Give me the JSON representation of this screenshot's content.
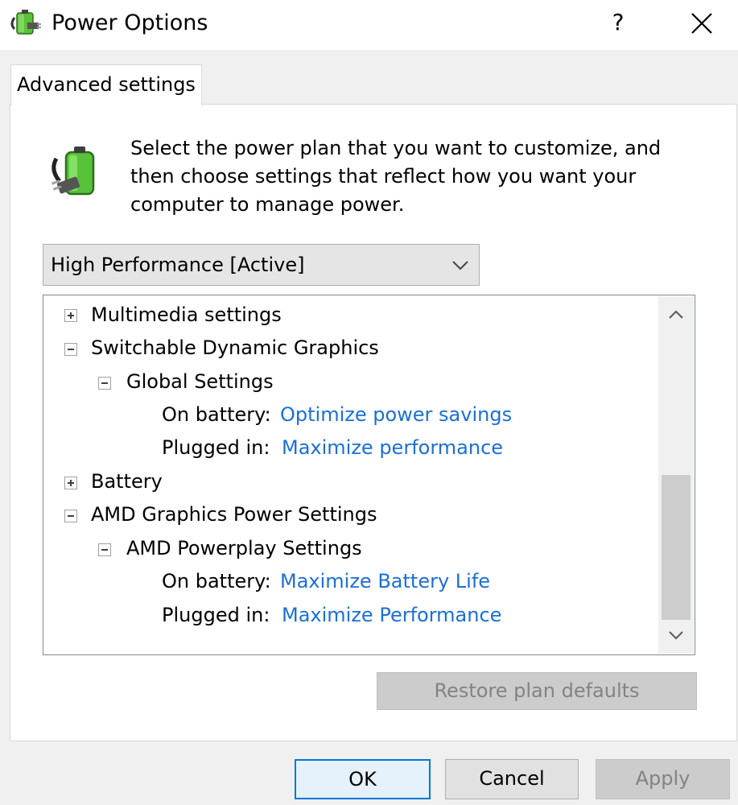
{
  "window": {
    "title": "Power Options",
    "help_label": "?",
    "close_icon": "close-icon",
    "app_icon": "power-options-icon"
  },
  "tab": {
    "label": "Advanced settings"
  },
  "description": "Select the power plan that you want to customize, and then choose settings that reflect how you want your computer to manage power.",
  "plan_select": {
    "value": "High Performance [Active]",
    "icon": "chevron-down-icon"
  },
  "tree": {
    "multimedia": {
      "label": "Multimedia settings",
      "state": "collapsed"
    },
    "switchable": {
      "label": "Switchable Dynamic Graphics",
      "state": "expanded",
      "global": {
        "label": "Global Settings",
        "state": "expanded",
        "on_battery_label": "On battery:",
        "on_battery_value": "Optimize power savings",
        "plugged_in_label": "Plugged in:",
        "plugged_in_value": "Maximize performance"
      }
    },
    "battery": {
      "label": "Battery",
      "state": "collapsed"
    },
    "amd": {
      "label": "AMD Graphics Power Settings",
      "state": "expanded",
      "powerplay": {
        "label": "AMD Powerplay Settings",
        "state": "expanded",
        "on_battery_label": "On battery:",
        "on_battery_value": "Maximize Battery Life",
        "plugged_in_label": "Plugged in:",
        "plugged_in_value": "Maximize Performance"
      }
    }
  },
  "scrollbar": {
    "position": "bottom"
  },
  "buttons": {
    "restore": "Restore plan defaults",
    "ok": "OK",
    "cancel": "Cancel",
    "apply": "Apply"
  },
  "colors": {
    "link": "#1a6fd6",
    "focus_border": "#0078d7",
    "disabled_text": "#838383"
  }
}
